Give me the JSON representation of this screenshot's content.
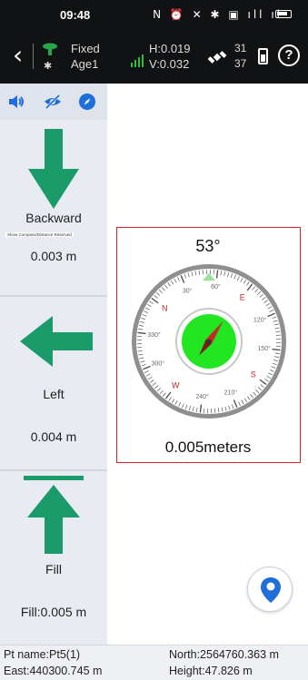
{
  "status_bar": {
    "time": "09:48",
    "icons": [
      "nfc-icon",
      "alarm-icon",
      "mute-icon",
      "bluetooth-icon",
      "vibrate-icon",
      "signal-icon",
      "wifi-icon",
      "battery-icon"
    ]
  },
  "header": {
    "fix_status": "Fixed",
    "age": "Age1",
    "h_precision": "H:0.019",
    "v_precision": "V:0.032",
    "satellites_used": "31",
    "satellites_tracked": "37",
    "help_symbol": "?"
  },
  "left_panel": {
    "toolbar_icons": [
      "volume-icon",
      "hide-eye-icon",
      "compass-icon"
    ],
    "backward": {
      "label": "Backward",
      "value": "0.003 m"
    },
    "note": "Show Compass/Distance Reserved",
    "left": {
      "label": "Left",
      "value": "0.004 m"
    },
    "fill": {
      "label": "Fill",
      "value": "Fill:0.005 m"
    }
  },
  "compass": {
    "angle": "53°",
    "distance": "0.005meters",
    "heading_deg": 53,
    "cardinals": [
      "N",
      "E",
      "S",
      "W"
    ],
    "degree_labels": [
      "30°",
      "60°",
      "120°",
      "150°",
      "210°",
      "240°",
      "300°",
      "330°"
    ]
  },
  "footer": {
    "pt_name": "Pt name:Pt5(1)",
    "north": "North:2564760.363 m",
    "east": "East:440300.745 m",
    "height": "Height:47.826 m"
  },
  "colors": {
    "arrow_green": "#1b9b6a",
    "compass_green": "#22e622",
    "needle_red": "#c62828",
    "accent_blue": "#1e6fd9",
    "frame_red": "#e02020"
  }
}
